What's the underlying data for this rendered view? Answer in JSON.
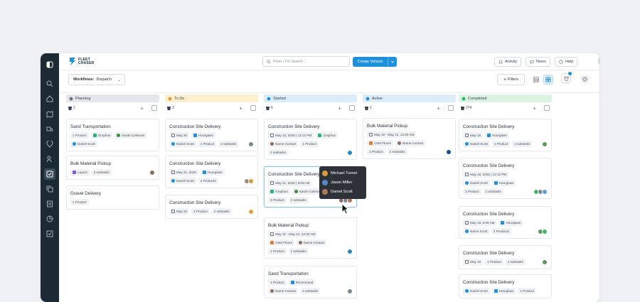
{
  "brand": {
    "line1": "FLEET",
    "line2": "CHASER"
  },
  "search": {
    "placeholder": "Press / For Search ..."
  },
  "header": {
    "create_label": "Create Vehicle",
    "activity_label": "Activity",
    "news_label": "News",
    "help_label": "Help"
  },
  "subbar": {
    "workflow_label": "Workflows:",
    "workflow_value": "Dispatch",
    "filters_label": "Filters"
  },
  "sidebar": {
    "items": [
      "logo-icon",
      "search-icon",
      "home-icon",
      "map-icon",
      "truck-icon",
      "location-icon",
      "users-icon",
      "dispatch-icon",
      "copy-icon",
      "document-icon",
      "chart-icon",
      "checklist-icon"
    ],
    "active_index": 7
  },
  "columns": [
    {
      "name": "Planning",
      "count": "2",
      "color": "#e3e6ea",
      "cards": [
        {
          "title": "Sand Transportation",
          "rows": [
            [
              {
                "t": "1 Product"
              },
              {
                "t": "Graphus",
                "c": "#22b573"
              },
              {
                "t": "Sarah Coleman",
                "d": "#3d8b3d"
              }
            ],
            [
              {
                "t": "Daniel Scott",
                "d": "#1e90dc"
              }
            ]
          ],
          "avatars": []
        },
        {
          "title": "Bulk Material Pickup",
          "rows": [
            [
              {
                "t": "Layers",
                "c": "#7b5cd6"
              },
              {
                "t": "2 subtasks"
              }
            ]
          ],
          "avatars": [
            "#8a6f5c"
          ]
        },
        {
          "title": "Gravel Delivery",
          "rows": [
            [
              {
                "t": "1 Product"
              }
            ]
          ],
          "avatars": []
        }
      ]
    },
    {
      "name": "To Do",
      "count": "3",
      "color": "#fdf0cf",
      "cards": [
        {
          "title": "Construction Site Delivery",
          "rows": [
            [
              {
                "t": "May 20"
              },
              {
                "t": "Hourglass",
                "c": "#1e90dc"
              }
            ],
            [
              {
                "t": "Daniel Scott",
                "d": "#1e90dc"
              },
              {
                "t": "1 Product"
              },
              {
                "t": "2 subtasks"
              }
            ]
          ],
          "avatars": [
            "#7d8793"
          ]
        },
        {
          "title": "Construction Site Delivery",
          "rows": [
            [
              {
                "t": "May 21, 2026"
              },
              {
                "t": "Hourglass",
                "c": "#1e90dc"
              }
            ],
            [
              {
                "t": "Daniel Scott",
                "d": "#1e90dc"
              },
              {
                "t": "4 Products"
              }
            ]
          ],
          "avatars": [
            "#9a8a7a",
            "#d99a3b"
          ]
        },
        {
          "title": "Construction Site Delivery",
          "rows": [
            [
              {
                "t": "May 22"
              },
              {
                "t": "1 Product"
              },
              {
                "t": "2 subtasks"
              }
            ]
          ],
          "avatars": [
            "#d9a53b"
          ]
        }
      ]
    },
    {
      "name": "Started",
      "count": "6",
      "color": "#dcedf9",
      "cards": [
        {
          "title": "Construction Site Delivery",
          "rows": [
            [
              {
                "t": "May 12, 2025 | 12:12 PM"
              },
              {
                "t": "Graphus",
                "c": "#22b573"
              }
            ],
            [
              {
                "t": "Name Contact",
                "d": "#8a6f5c"
              },
              {
                "t": "1 Product"
              }
            ],
            [
              {
                "t": "2 subtasks"
              }
            ]
          ],
          "avatars": [
            "#2e86c1"
          ]
        },
        {
          "title": "Construction Site Delivery",
          "rows": [
            [
              {
                "t": "May 21, 2026 | 6:00 AM"
              }
            ],
            [
              {
                "t": "Graphus",
                "c": "#22b573"
              },
              {
                "t": "Sarah Coleman",
                "d": "#3d8b3d"
              }
            ],
            [
              {
                "t": "3 Product"
              },
              {
                "t": "2 subtasks"
              }
            ]
          ],
          "avatars": [
            "#8a6f5c",
            "#7d8793",
            "#b07a5a"
          ]
        },
        {
          "title": "Bulk Material Pickup",
          "rows": [
            [
              {
                "t": "May 10 - May 12, 12:30 AM"
              }
            ],
            [
              {
                "t": "ASM Floors",
                "c": "#e07b39"
              },
              {
                "t": "Name Contact",
                "d": "#8a6f5c"
              }
            ],
            [
              {
                "t": "1 Product"
              },
              {
                "t": "2 subtasks"
              }
            ]
          ],
          "avatars": [
            "#2e86c1"
          ]
        },
        {
          "title": "Sand Transportation",
          "rows": [
            [
              {
                "t": "1 Product"
              },
              {
                "t": "RCommand",
                "c": "#1e90dc"
              }
            ],
            [
              {
                "t": "Name Contact",
                "d": "#8a6f5c"
              },
              {
                "t": "2 subtasks"
              }
            ]
          ],
          "avatars": [
            "#7d8793"
          ]
        }
      ]
    },
    {
      "name": "Active",
      "count": "1",
      "color": "#dcedf9",
      "cards": [
        {
          "title": "Bulk Material Pickup",
          "rows": [
            [
              {
                "t": "May 10 - May 12, 12:30 AM"
              }
            ],
            [
              {
                "t": "ASM Floors",
                "c": "#e07b39"
              },
              {
                "t": "Name Contact",
                "d": "#8a6f5c"
              }
            ],
            [
              {
                "t": "1 Product"
              },
              {
                "t": "2 subtasks"
              }
            ]
          ],
          "avatars": [
            "#1b4f8a"
          ]
        }
      ]
    },
    {
      "name": "Completed",
      "count": "274",
      "color": "#dcf3e3",
      "cards": [
        {
          "title": "Construction Site Delivery",
          "rows": [
            [
              {
                "t": "May 19"
              },
              {
                "t": "Hourglass",
                "c": "#1e90dc"
              }
            ],
            [
              {
                "t": "Daniel Scott",
                "d": "#1e90dc"
              },
              {
                "t": "1 Product"
              },
              {
                "t": "2 subtasks"
              }
            ]
          ],
          "avatars": [
            "#5a9a5a"
          ]
        },
        {
          "title": "Construction Site Delivery",
          "rows": [
            [
              {
                "t": "May 18, 2025 | 12:12 PM"
              }
            ],
            [
              {
                "t": "Daniel Scott",
                "d": "#1e90dc"
              },
              {
                "t": "Hourglass",
                "c": "#1e90dc"
              }
            ],
            [
              {
                "t": "3 Product"
              },
              {
                "t": "2 subtasks"
              }
            ]
          ],
          "avatars": [
            "#3db56a",
            "#7d8793",
            "#5a9fd6"
          ]
        },
        {
          "title": "Construction Site Delivery",
          "rows": [
            [
              {
                "t": "May 19, 6:00 AM"
              },
              {
                "t": "Hourglass",
                "c": "#1e90dc"
              }
            ],
            [
              {
                "t": "Name Scott",
                "d": "#1e90dc"
              },
              {
                "t": "4 Products"
              }
            ]
          ],
          "avatars": [
            "#5a9a5a",
            "#3db56a"
          ]
        },
        {
          "title": "Construction Site Delivery",
          "rows": [
            [
              {
                "t": "May 18"
              },
              {
                "t": "1 Product"
              },
              {
                "t": "2 subtasks"
              }
            ]
          ],
          "avatars": [
            "#5a9a5a"
          ]
        },
        {
          "title": "Construction Site Delivery",
          "rows": [
            [
              {
                "t": "Daniel Scott",
                "d": "#1e90dc"
              },
              {
                "t": "Hourglass",
                "c": "#1e90dc"
              },
              {
                "t": "1 Product"
              }
            ]
          ],
          "avatars": []
        }
      ]
    }
  ],
  "tooltip": {
    "people": [
      {
        "name": "Michael Turner",
        "color": "#d99a3b"
      },
      {
        "name": "Jason Miller",
        "color": "#5a86c8"
      },
      {
        "name": "Daniel Scott",
        "color": "#b07a5a"
      }
    ]
  }
}
